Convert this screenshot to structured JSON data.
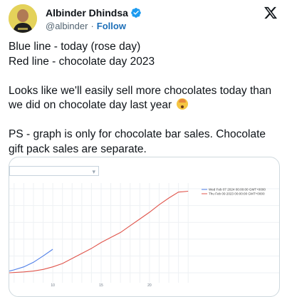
{
  "author": {
    "name": "Albinder Dhindsa",
    "handle": "@albinder",
    "separator": "·",
    "follow_label": "Follow"
  },
  "tweet": {
    "line1": "Blue line - today (rose day)",
    "line2": "Red line - chocolate day 2023",
    "paragraph2": "Looks like we'll easily sell more chocolates today than we did on chocolate day last year",
    "emoji": "exploding-head-emoji",
    "paragraph3": "PS - graph is only for chocolate bar sales. Chocolate gift pack sales are separate."
  },
  "colors": {
    "blue_series": "#4f7fe8",
    "red_series": "#e0554c",
    "follow": "#1d6fb8",
    "verified": "#1d9bf0"
  },
  "chart_data": {
    "type": "line",
    "x_ticks": [
      "10",
      "15",
      "20"
    ],
    "xlim": [
      5.5,
      24.5
    ],
    "ylim": [
      0,
      100
    ],
    "grid": true,
    "legend_position": "top-right",
    "series": [
      {
        "name": "Wed Feb 07 2024 00:00:00 GMT+0000",
        "color": "#4f7fe8",
        "x": [
          5.5,
          6,
          7,
          8,
          9,
          10
        ],
        "y": [
          2,
          3.5,
          7,
          12.5,
          20,
          28
        ]
      },
      {
        "name": "Thu Feb 09 2023 00:00:00 GMT+0000",
        "color": "#e0554c",
        "x": [
          5.5,
          7,
          8,
          9,
          10,
          11,
          12,
          13,
          14,
          15,
          16,
          17,
          18,
          19,
          20,
          21,
          22,
          23,
          24
        ],
        "y": [
          0,
          1,
          2,
          4,
          7,
          11,
          17,
          23,
          29,
          36,
          42,
          48,
          56,
          64,
          72,
          81,
          89,
          96,
          97
        ]
      }
    ]
  }
}
